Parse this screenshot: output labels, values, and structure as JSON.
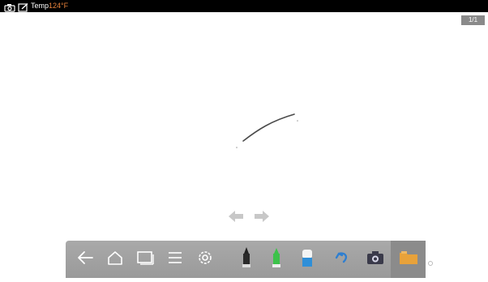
{
  "status_bar": {
    "temp_label": "Temp",
    "temp_value": "124°F",
    "icons": [
      "camera-icon",
      "edit-note-icon"
    ]
  },
  "page_indicator": "1/1",
  "canvas": {
    "stroke_color": "#4a4a4a",
    "background": "#ffffff"
  },
  "page_nav": {
    "icons": [
      "prev-page-arrow-icon",
      "next-page-arrow-icon"
    ]
  },
  "toolbar": {
    "buttons": [
      {
        "name": "back",
        "icon": "back-arrow-icon"
      },
      {
        "name": "home",
        "icon": "home-icon"
      },
      {
        "name": "window",
        "icon": "window-icon"
      },
      {
        "name": "menu",
        "icon": "menu-icon"
      },
      {
        "name": "settings",
        "icon": "gear-icon"
      },
      {
        "name": "pen",
        "icon": "pen-icon"
      },
      {
        "name": "highlighter",
        "icon": "highlighter-icon"
      },
      {
        "name": "eraser",
        "icon": "eraser-icon"
      },
      {
        "name": "undo",
        "icon": "undo-icon"
      },
      {
        "name": "screenshot",
        "icon": "camera-icon"
      },
      {
        "name": "folder",
        "icon": "folder-icon"
      }
    ],
    "colors": {
      "bar": "#9f9f9f",
      "highlighter": "#3cc24a",
      "eraser": "#2f8fd8",
      "undo": "#2f7fd0",
      "folder": "#e8a23a"
    }
  }
}
